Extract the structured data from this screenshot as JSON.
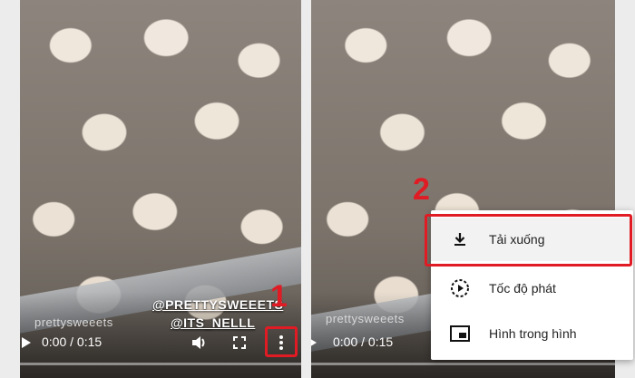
{
  "left_player": {
    "watermark": "prettysweeets",
    "credit_line1": "@PRETTYSWEEETS",
    "credit_line2": "@ITS_NELLL",
    "time": "0:00 / 0:15",
    "progress": 0,
    "icons": [
      "play-icon",
      "volume-icon",
      "fullscreen-icon",
      "more-vert-icon"
    ],
    "step_number": "1"
  },
  "right_player": {
    "watermark": "prettysweeets",
    "time": "0:00 / 0:15",
    "progress": 0,
    "step_number": "2",
    "menu": {
      "items": [
        {
          "label": "Tải xuống",
          "icon": "download-icon"
        },
        {
          "label": "Tốc độ phát",
          "icon": "playback-speed-icon"
        },
        {
          "label": "Hình trong hình",
          "icon": "picture-in-picture-icon"
        }
      ]
    }
  },
  "colors": {
    "highlight": "#e01b24",
    "menu_bg": "#ffffff",
    "page_bg": "#ececec"
  }
}
